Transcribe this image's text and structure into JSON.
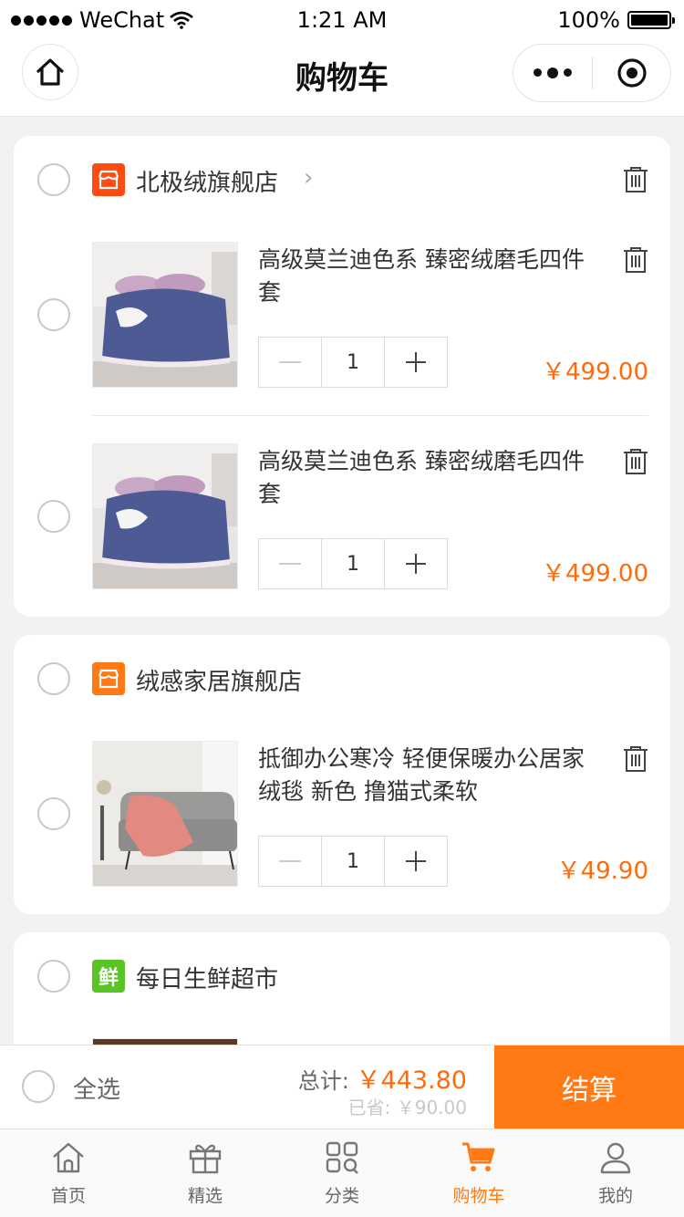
{
  "status_bar": {
    "carrier": "WeChat",
    "time": "1:21 AM",
    "battery": "100%"
  },
  "nav": {
    "title": "购物车"
  },
  "stores": [
    {
      "name": "北极绒旗舰店",
      "icon": "store-icon",
      "icon_color": "#ff4a12",
      "items": [
        {
          "title": "高级莫兰迪色系  臻密绒磨毛四件套",
          "quantity": "1",
          "price": "￥499.00",
          "image": "bedding-set-photo"
        },
        {
          "title": "高级莫兰迪色系  臻密绒磨毛四件套",
          "quantity": "1",
          "price": "￥499.00",
          "image": "bedding-set-photo"
        }
      ]
    },
    {
      "name": "绒感家居旗舰店",
      "icon": "store-icon",
      "icon_color": "#ff7a14",
      "items": [
        {
          "title": "抵御办公寒冷 轻便保暖办公居家绒毯 新色  撸猫式柔软",
          "quantity": "1",
          "price": "￥49.90",
          "image": "sofa-blanket-photo"
        }
      ]
    },
    {
      "name": "每日生鲜超市",
      "icon": "fresh-icon",
      "icon_glyph": "鲜",
      "icon_color": "#5ac425",
      "items": []
    }
  ],
  "checkout": {
    "select_all": "全选",
    "total_label": "总计:",
    "total_value": "￥443.80",
    "saved_label": "已省:",
    "saved_value": "￥90.00",
    "button": "结算"
  },
  "tabs": [
    {
      "label": "首页",
      "icon": "home-icon",
      "active": false
    },
    {
      "label": "精选",
      "icon": "gift-icon",
      "active": false
    },
    {
      "label": "分类",
      "icon": "category-icon",
      "active": false
    },
    {
      "label": "购物车",
      "icon": "cart-icon",
      "active": true
    },
    {
      "label": "我的",
      "icon": "user-icon",
      "active": false
    }
  ],
  "colors": {
    "accent": "#ff7a14",
    "price": "#ff6b0a"
  }
}
